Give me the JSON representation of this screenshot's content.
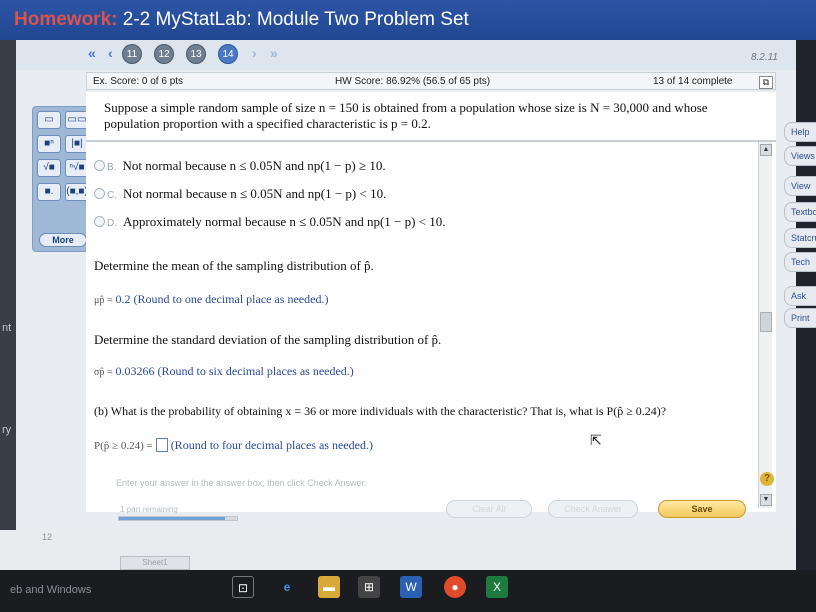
{
  "window": {
    "title_prefix": "Homework:",
    "title": "2-2 MyStatLab: Module Two Problem Set"
  },
  "nav": {
    "first": "«",
    "prev": "‹",
    "next": "›",
    "last": "»",
    "questions": [
      "11",
      "12",
      "13",
      "14"
    ],
    "current_question": "14",
    "version": "8.2.11"
  },
  "score": {
    "ex_score": "Ex. Score: 0 of 6 pts",
    "hw_score": "HW Score: 86.92% (56.5 of 65 pts)",
    "complete": "13 of 14 complete"
  },
  "palette": {
    "more": "More"
  },
  "problem": {
    "statement": "Suppose a simple random sample of size n = 150 is obtained from a population whose size is N = 30,000 and whose population proportion with a specified characteristic is p = 0.2."
  },
  "choices": [
    {
      "letter": "B.",
      "text": "Not normal because n ≤ 0.05N and np(1 − p) ≥ 10."
    },
    {
      "letter": "C.",
      "text": "Not normal because n ≤ 0.05N and np(1 − p) < 10."
    },
    {
      "letter": "D.",
      "text": "Approximately normal because n ≤ 0.05N and np(1 − p) < 10."
    }
  ],
  "mean": {
    "question": "Determine the mean of the sampling distribution of p̂.",
    "symbol": "μp̂ =",
    "value": "0.2",
    "hint": "(Round to one decimal place as needed.)"
  },
  "stdev": {
    "question": "Determine the standard deviation of the sampling distribution of p̂.",
    "symbol": "σp̂ =",
    "value": "0.03266",
    "hint": "(Round to six decimal places as needed.)"
  },
  "part_b": {
    "question": "(b) What is the probability of obtaining x = 36 or more individuals with the characteristic? That is, what is P(p̂ ≥ 0.24)?",
    "prompt": "P(p̂ ≥ 0.24) =",
    "hint": "(Round to four decimal places as needed.)"
  },
  "footer": {
    "instructions": "Enter your answer in the answer box, then click Check Answer.",
    "parts_remaining": "1 part remaining",
    "progress_fraction": 0.9,
    "clear_all": "Clear All",
    "check_answer": "Check Answer",
    "save": "Save"
  },
  "right_menu": [
    "Help",
    "Views",
    "View",
    "Textbook",
    "Statcrunch",
    "Tech",
    "Ask",
    "Print"
  ],
  "left_strip": [
    "nt",
    "ry"
  ],
  "bottom": {
    "sheet": "Sheet1",
    "row_number": "12",
    "taskbar_search": "eb and Windows"
  }
}
